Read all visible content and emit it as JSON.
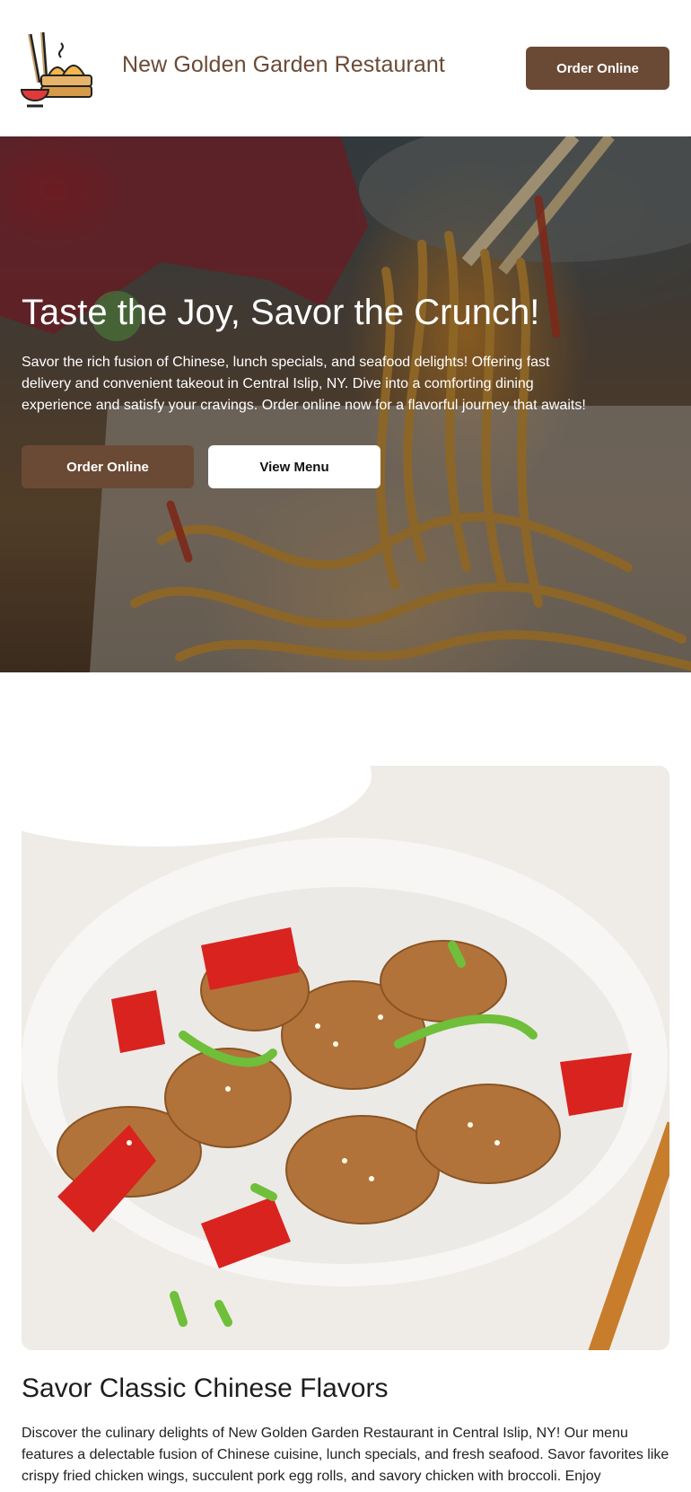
{
  "header": {
    "brand": "New Golden Garden Restaurant",
    "order_label": "Order Online",
    "logo_icon": "dim-sum-steamer-chopsticks-icon"
  },
  "hero": {
    "title": "Taste the Joy, Savor the Crunch!",
    "description": "Savor the rich fusion of Chinese, lunch specials, and seafood delights! Offering fast delivery and convenient takeout in Central Islip, NY. Dive into a comforting dining experience and satisfy your cravings. Order online now for a flavorful journey that awaits!",
    "order_label": "Order Online",
    "menu_label": "View Menu",
    "image": "noodles-with-chopsticks-photo"
  },
  "feature": {
    "image": "chicken-stir-fry-bowl-photo",
    "title": "Savor Classic Chinese Flavors",
    "description": "Discover the culinary delights of New Golden Garden Restaurant in Central Islip, NY! Our menu features a delectable fusion of Chinese cuisine, lunch specials, and fresh seafood. Savor favorites like crispy fried chicken wings, succulent pork egg rolls, and savory chicken with broccoli. Enjoy"
  },
  "colors": {
    "brand_brown": "#6b4a35",
    "white": "#ffffff",
    "text_dark": "#1f1f1f"
  }
}
